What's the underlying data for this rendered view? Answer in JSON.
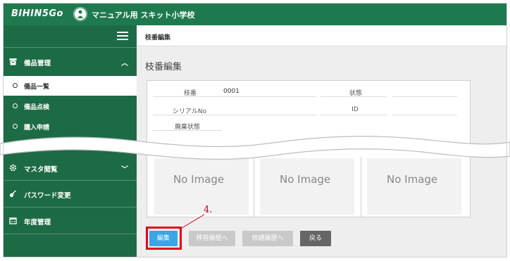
{
  "header": {
    "brand": "BIHIN5Go",
    "school_name": "マニュアル用 スキット小学校"
  },
  "sidebar": {
    "sections": [
      {
        "label": "備品管理",
        "chevron": "︿"
      },
      {
        "label": "マスタ閲覧",
        "chevron": "﹀"
      },
      {
        "label": "パスワード変更"
      },
      {
        "label": "年度管理"
      }
    ],
    "sub_items": [
      {
        "label": "備品一覧",
        "active": true
      },
      {
        "label": "備品点検"
      },
      {
        "label": "購入申請"
      }
    ]
  },
  "main": {
    "breadcrumb": "枝番編集",
    "page_title": "枝番編集",
    "fields": {
      "branch_label": "枝番",
      "branch_value": "0001",
      "status_label": "状態",
      "serial_label": "シリアルNo",
      "id_label": "ID",
      "disposal_label": "廃棄状態"
    },
    "images": [
      "No Image",
      "No Image",
      "No Image"
    ],
    "buttons": {
      "edit": "編集",
      "transfer_history": "移管履歴へ",
      "repair_history": "修繕履歴へ",
      "back": "戻る"
    }
  },
  "annotation": {
    "step": "4."
  },
  "colors": {
    "header_green": "#1e7a4e",
    "sidebar_green": "#1d6b45",
    "edit_blue": "#3aa6e6",
    "highlight_red": "#e3001b"
  }
}
